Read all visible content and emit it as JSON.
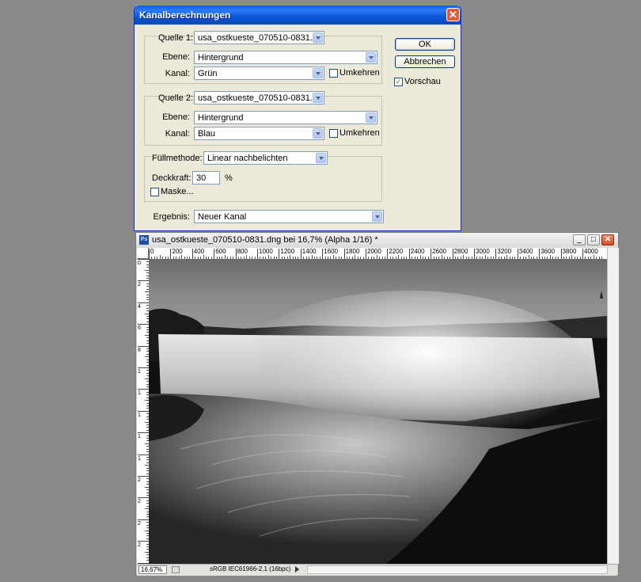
{
  "dialog": {
    "title": "Kanalberechnungen",
    "close_glyph": "✕",
    "source1": {
      "label": "Quelle 1:",
      "value": "usa_ostkueste_070510-0831...",
      "layer_label": "Ebene:",
      "layer_value": "Hintergrund",
      "channel_label": "Kanal:",
      "channel_value": "Grün",
      "invert_label": "Umkehren",
      "invert_checked": false
    },
    "source2": {
      "label": "Quelle 2:",
      "value": "usa_ostkueste_070510-0831...",
      "layer_label": "Ebene:",
      "layer_value": "Hintergrund",
      "channel_label": "Kanal:",
      "channel_value": "Blau",
      "invert_label": "Umkehren",
      "invert_checked": false
    },
    "blend": {
      "mode_label": "Füllmethode:",
      "mode_value": "Linear nachbelichten",
      "opacity_label": "Deckkraft:",
      "opacity_value": "30",
      "opacity_unit": "%",
      "mask_label": "Maske...",
      "mask_checked": false
    },
    "result": {
      "label": "Ergebnis:",
      "value": "Neuer Kanal"
    },
    "buttons": {
      "ok": "OK",
      "cancel": "Abbrechen"
    },
    "preview": {
      "label": "Vorschau",
      "checked": true,
      "check_glyph": "✓"
    }
  },
  "image_window": {
    "app_icon": "Ps",
    "title": "usa_ostkueste_070510-0831.dng bei 16,7% (Alpha 1/16) *",
    "buttons": {
      "minimize": "_",
      "maximize": "□",
      "close": "✕"
    },
    "ruler_h_labels": [
      "0",
      "200",
      "400",
      "600",
      "800",
      "1000",
      "1200",
      "1400",
      "1600",
      "1800",
      "2000",
      "2200",
      "2400",
      "2600",
      "2800",
      "3000",
      "3200",
      "3400",
      "3600",
      "3800",
      "4000"
    ],
    "ruler_v_labels": [
      "0",
      "2",
      "4",
      "6",
      "8",
      "1",
      "1",
      "1",
      "1",
      "1",
      "2",
      "2",
      "2",
      "2",
      "2"
    ],
    "zoom": "16,67%",
    "status_text": "sRGB IEC61966-2.1 (16bpc)",
    "image_description_icon": "niagara-falls-photo"
  }
}
